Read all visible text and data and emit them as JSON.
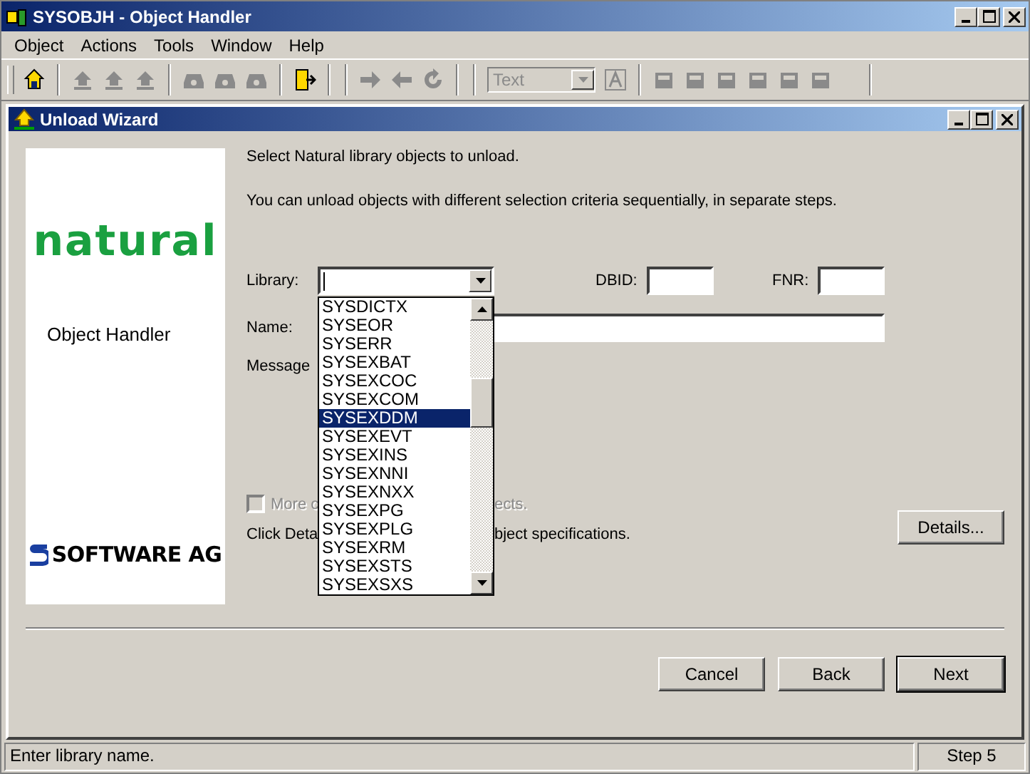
{
  "window": {
    "title": "SYSOBJH - Object Handler"
  },
  "menu": [
    "Object",
    "Actions",
    "Tools",
    "Window",
    "Help"
  ],
  "toolbar": {
    "style_combo": {
      "value": "Text",
      "disabled": true
    }
  },
  "wizard": {
    "title": "Unload Wizard",
    "logo_top": "natural",
    "product": "Object Handler",
    "logo_bottom": "SOFTWARE AG",
    "intro": [
      "Select Natural library objects to unload.",
      "You can unload objects with different selection criteria sequentially, in separate steps."
    ],
    "library": {
      "label": "Library:",
      "items": [
        {
          "label": "SYSDICTX",
          "selected": false
        },
        {
          "label": "SYSEOR",
          "selected": false
        },
        {
          "label": "SYSERR",
          "selected": false
        },
        {
          "label": "SYSEXBAT",
          "selected": false
        },
        {
          "label": "SYSEXCOC",
          "selected": false
        },
        {
          "label": "SYSEXCOM",
          "selected": false
        },
        {
          "label": "SYSEXDDM",
          "selected": true
        },
        {
          "label": "SYSEXEVT",
          "selected": false
        },
        {
          "label": "SYSEXINS",
          "selected": false
        },
        {
          "label": "SYSEXNNI",
          "selected": false
        },
        {
          "label": "SYSEXNXX",
          "selected": false
        },
        {
          "label": "SYSEXPG",
          "selected": false
        },
        {
          "label": "SYSEXPLG",
          "selected": false
        },
        {
          "label": "SYSEXRM",
          "selected": false
        },
        {
          "label": "SYSEXSTS",
          "selected": false
        },
        {
          "label": "SYSEXSXS",
          "selected": false
        }
      ]
    },
    "dbid_label": "DBID:",
    "fnr_label": "FNR:",
    "name_label": "Name:",
    "message_label": "Message",
    "more": {
      "label_start": "More c",
      "label_end": "ects.",
      "checked": false,
      "disabled": true
    },
    "hint": {
      "start": "Click Deta",
      "end": "bject specifications."
    },
    "details_button": "Details...",
    "buttons": [
      {
        "label": "Cancel",
        "default": false
      },
      {
        "label": "Back",
        "default": false
      },
      {
        "label": "Next",
        "default": true
      }
    ]
  },
  "status_bar": {
    "message": "Enter library name.",
    "step": "Step 5"
  }
}
